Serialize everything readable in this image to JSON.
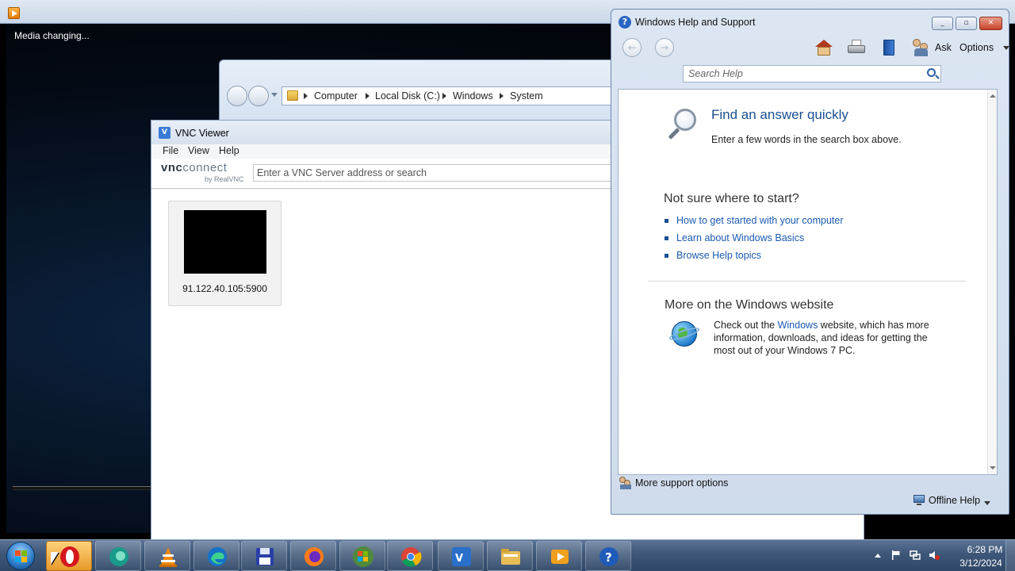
{
  "media_player": {
    "status_text": "Media changing..."
  },
  "explorer": {
    "breadcrumb": [
      "Computer",
      "Local Disk (C:)",
      "Windows",
      "System"
    ]
  },
  "vnc_viewer": {
    "title": "VNC Viewer",
    "menu": [
      "File",
      "View",
      "Help"
    ],
    "logo_main": "vnc",
    "logo_main_light": "connect",
    "logo_sub": "by RealVNC",
    "search_placeholder": "Enter a VNC Server address or search",
    "connections": [
      {
        "address": "91.122.40.105:5900"
      }
    ]
  },
  "help_window": {
    "title": "Windows Help and Support",
    "toolbar": {
      "ask_label": "Ask",
      "options_label": "Options"
    },
    "search_placeholder": "Search Help",
    "find": {
      "heading": "Find an answer quickly",
      "subtext": "Enter a few words in the search box above."
    },
    "not_sure": {
      "heading": "Not sure where to start?",
      "links": [
        "How to get started with your computer",
        "Learn about Windows Basics",
        "Browse Help topics"
      ]
    },
    "more": {
      "heading": "More on the Windows website",
      "text_before": "Check out the ",
      "link": "Windows",
      "text_after": " website, which has more information, downloads, and ideas for getting the most out of your Windows 7 PC."
    },
    "footer": {
      "support_label": "More support options",
      "offline_label": "Offline Help"
    }
  },
  "taskbar": {
    "apps": [
      "opera",
      "edge-legacy",
      "vlc",
      "edge",
      "save-disk",
      "firefox",
      "windows-flag",
      "chrome",
      "vnc",
      "file-explorer",
      "media-player",
      "help"
    ],
    "active_app": "opera",
    "clock": {
      "time": "6:28 PM",
      "date": "3/12/2024"
    }
  },
  "colors": {
    "accent_link": "#1a5ab0",
    "heading_blue": "#1a4f93"
  }
}
